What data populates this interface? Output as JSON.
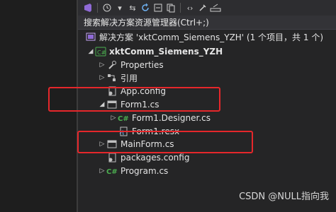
{
  "toolbar": {
    "icons": [
      "vs-icon",
      "history-icon",
      "sync-icon",
      "refresh-icon",
      "collapse-icon",
      "show-all-files-icon",
      "code-icon",
      "properties-icon",
      "preview-icon"
    ]
  },
  "search": {
    "placeholder": "搜索解决方案资源管理器(Ctrl+;)"
  },
  "tree": {
    "solution": "解决方案 'xktComm_Siemens_YZH' (1 个项目，共 1 个)",
    "project": "xktComm_Siemens_YZH",
    "items": [
      {
        "label": "Properties",
        "icon": "wrench-icon"
      },
      {
        "label": "引用",
        "icon": "references-icon"
      },
      {
        "label": "App.config",
        "icon": "config-icon"
      },
      {
        "label": "Form1.cs",
        "icon": "form-icon"
      },
      {
        "label": "Form1.Designer.cs",
        "icon": "csharp-icon"
      },
      {
        "label": "Form1.resx",
        "icon": "resx-icon"
      },
      {
        "label": "MainForm.cs",
        "icon": "form-icon"
      },
      {
        "label": "packages.config",
        "icon": "config-icon"
      },
      {
        "label": "Program.cs",
        "icon": "csharp-icon"
      }
    ]
  },
  "watermark": "CSDN @NULL指向我",
  "colors": {
    "highlight": "#e6272b",
    "csharp": "#4caf50",
    "wrench": "#c0c0c0"
  }
}
